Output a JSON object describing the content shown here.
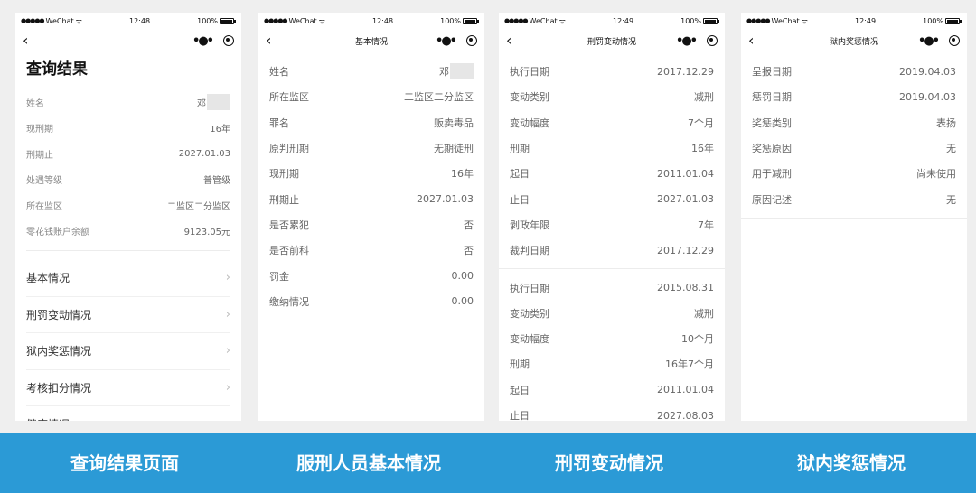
{
  "status": {
    "carrier": "WeChat",
    "battery": "100%",
    "times": [
      "12:48",
      "12:48",
      "12:49",
      "12:49"
    ]
  },
  "screen1": {
    "heading": "查询结果",
    "rows": [
      {
        "label": "姓名",
        "value": "邓"
      },
      {
        "label": "现刑期",
        "value": "16年"
      },
      {
        "label": "刑期止",
        "value": "2027.01.03"
      },
      {
        "label": "处遇等级",
        "value": "普管级"
      },
      {
        "label": "所在监区",
        "value": "二监区二分监区"
      },
      {
        "label": "零花钱账户余额",
        "value": "9123.05元"
      }
    ],
    "menu": [
      "基本情况",
      "刑罚变动情况",
      "狱内奖惩情况",
      "考核扣分情况",
      "健康情况"
    ]
  },
  "screen2": {
    "title": "基本情况",
    "rows": [
      {
        "label": "姓名",
        "value": "邓"
      },
      {
        "label": "所在监区",
        "value": "二监区二分监区"
      },
      {
        "label": "罪名",
        "value": "贩卖毒品"
      },
      {
        "label": "原判刑期",
        "value": "无期徒刑"
      },
      {
        "label": "现刑期",
        "value": "16年"
      },
      {
        "label": "刑期止",
        "value": "2027.01.03"
      },
      {
        "label": "是否累犯",
        "value": "否"
      },
      {
        "label": "是否前科",
        "value": "否"
      },
      {
        "label": "罚金",
        "value": "0.00"
      },
      {
        "label": "缴纳情况",
        "value": "0.00"
      }
    ]
  },
  "screen3": {
    "title": "刑罚变动情况",
    "group1": [
      {
        "label": "执行日期",
        "value": "2017.12.29"
      },
      {
        "label": "变动类别",
        "value": "减刑"
      },
      {
        "label": "变动幅度",
        "value": "7个月"
      },
      {
        "label": "刑期",
        "value": "16年"
      },
      {
        "label": "起日",
        "value": "2011.01.04"
      },
      {
        "label": "止日",
        "value": "2027.01.03"
      },
      {
        "label": "剥政年限",
        "value": "7年"
      },
      {
        "label": "裁判日期",
        "value": "2017.12.29"
      }
    ],
    "group2": [
      {
        "label": "执行日期",
        "value": "2015.08.31"
      },
      {
        "label": "变动类别",
        "value": "减刑"
      },
      {
        "label": "变动幅度",
        "value": "10个月"
      },
      {
        "label": "刑期",
        "value": "16年7个月"
      },
      {
        "label": "起日",
        "value": "2011.01.04"
      },
      {
        "label": "止日",
        "value": "2027.08.03"
      }
    ]
  },
  "screen4": {
    "title": "狱内奖惩情况",
    "rows": [
      {
        "label": "呈报日期",
        "value": "2019.04.03"
      },
      {
        "label": "惩罚日期",
        "value": "2019.04.03"
      },
      {
        "label": "奖惩类别",
        "value": "表扬"
      },
      {
        "label": "奖惩原因",
        "value": "无"
      },
      {
        "label": "用于减刑",
        "value": "尚未使用"
      },
      {
        "label": "原因记述",
        "value": "无"
      }
    ]
  },
  "captions": [
    "查询结果页面",
    "服刑人员基本情况",
    "刑罚变动情况",
    "狱内奖惩情况"
  ],
  "colors": {
    "banner": "#2b9ad6"
  }
}
